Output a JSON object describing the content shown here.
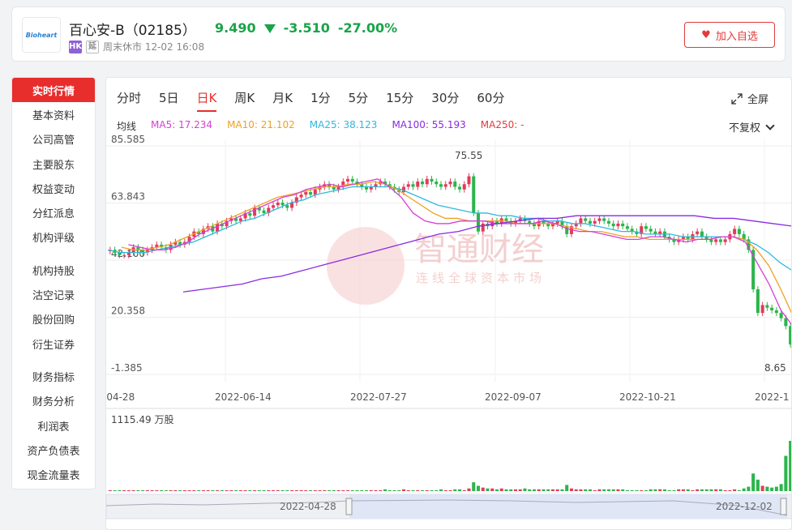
{
  "header": {
    "logo_text": "Bioheart",
    "stock_name": "百心安-B（02185）",
    "price": "9.490",
    "change": "-3.510",
    "change_pct": "-27.00%",
    "market_tag": "HK",
    "delay_tag": "延",
    "status": "周末休市 12-02 16:08",
    "follow_label": "加入自选",
    "down_color": "#1aa34a",
    "up_color": "#e23b3b"
  },
  "sidebar": {
    "groups": [
      [
        "实时行情",
        "基本资料",
        "公司高管",
        "主要股东",
        "权益变动",
        "分红派息",
        "机构评级"
      ],
      [
        "机构持股",
        "沽空记录",
        "股份回购",
        "衍生证券"
      ],
      [
        "财务指标",
        "财务分析",
        "利润表",
        "资产负债表",
        "现金流量表"
      ]
    ]
  },
  "chart": {
    "tabs": [
      "分时",
      "5日",
      "日K",
      "周K",
      "月K",
      "1分",
      "5分",
      "15分",
      "30分",
      "60分"
    ],
    "active_tab": "日K",
    "fullscreen_label": "全屏",
    "ma_label": "均线",
    "ma": [
      {
        "label": "MA5: 17.234",
        "color": "#d63fd6"
      },
      {
        "label": "MA10: 21.102",
        "color": "#f0a020"
      },
      {
        "label": "MA25: 38.123",
        "color": "#2fb8e0"
      },
      {
        "label": "MA100: 55.193",
        "color": "#8a2be2"
      },
      {
        "label": "MA250: -",
        "color": "#e23b3b"
      }
    ],
    "adjust_label": "不复权",
    "y_labels": [
      "85.585",
      "63.843",
      "42.100",
      "20.358",
      "-1.385"
    ],
    "x_labels": [
      "-04-28",
      "2022-06-14",
      "2022-07-27",
      "2022-09-07",
      "2022-10-21",
      "2022-1"
    ],
    "high_label": "75.55",
    "low_label": "8.65",
    "volume_label": "1115.49 万股",
    "nav_start": "2022-04-28",
    "nav_end": "2022-12-02",
    "watermark_title": "智通财经",
    "watermark_sub": "连线全球资本市场"
  },
  "chart_data": {
    "type": "candlestick",
    "ylim": [
      -1.385,
      85.585
    ],
    "close_series": [
      46,
      45,
      44,
      44,
      45,
      47,
      46,
      45,
      46,
      47,
      48,
      47,
      46,
      48,
      49,
      48,
      49,
      51,
      53,
      52,
      54,
      55,
      53,
      56,
      55,
      57,
      58,
      57,
      58,
      60,
      59,
      62,
      61,
      60,
      62,
      63,
      64,
      63,
      62,
      64,
      66,
      67,
      68,
      67,
      69,
      70,
      71,
      70,
      69,
      70,
      72,
      73,
      72,
      71,
      70,
      69,
      70,
      71,
      72,
      71,
      70,
      69,
      68,
      70,
      71,
      70,
      72,
      71,
      73,
      72,
      71,
      70,
      71,
      72,
      70,
      69,
      71,
      74,
      60,
      53,
      56,
      55,
      57,
      56,
      58,
      57,
      56,
      57,
      58,
      57,
      56,
      55,
      57,
      56,
      55,
      56,
      57,
      55,
      52,
      55,
      56,
      58,
      57,
      56,
      57,
      58,
      57,
      56,
      55,
      56,
      55,
      54,
      53,
      52,
      55,
      54,
      53,
      52,
      53,
      51,
      50,
      49,
      50,
      51,
      50,
      52,
      53,
      51,
      50,
      49,
      50,
      49,
      50,
      52,
      54,
      52,
      50,
      46,
      31,
      22,
      25,
      24,
      23,
      22,
      20,
      17,
      10
    ],
    "ma5": [
      48,
      47,
      46,
      46,
      47,
      49,
      52,
      54,
      56,
      58,
      60,
      62,
      64,
      66,
      67,
      69,
      70,
      71,
      70,
      71,
      72,
      73,
      70,
      66,
      60,
      57,
      56,
      56,
      57,
      57,
      57,
      56,
      56,
      56,
      56,
      57,
      56,
      54,
      53,
      53,
      52,
      51,
      50,
      50,
      51,
      51,
      50,
      49,
      50,
      50,
      51,
      51,
      49,
      41,
      33,
      23,
      17
    ],
    "ma10": [
      47,
      46,
      46,
      47,
      48,
      50,
      52,
      54,
      56,
      58,
      60,
      62,
      64,
      66,
      67,
      68,
      69,
      70,
      70,
      71,
      71,
      72,
      71,
      69,
      66,
      63,
      60,
      58,
      58,
      57,
      57,
      57,
      57,
      56,
      56,
      56,
      56,
      55,
      54,
      53,
      53,
      52,
      51,
      51,
      50,
      50,
      50,
      50,
      50,
      50,
      51,
      51,
      50,
      46,
      40,
      31,
      21
    ],
    "ma25": [
      46,
      45,
      45,
      45,
      46,
      47,
      48,
      49,
      51,
      53,
      55,
      57,
      58,
      60,
      62,
      64,
      65,
      67,
      68,
      69,
      70,
      70,
      70,
      70,
      69,
      67,
      65,
      63,
      62,
      61,
      60,
      60,
      59,
      59,
      58,
      58,
      57,
      57,
      56,
      56,
      55,
      54,
      53,
      53,
      52,
      52,
      52,
      51,
      51,
      51,
      51,
      51,
      50,
      48,
      45,
      41,
      38
    ],
    "ma100": [
      30,
      31,
      32,
      33,
      35,
      36,
      38,
      40,
      42,
      44,
      46,
      48,
      50,
      52,
      53,
      55,
      56,
      57,
      58,
      58,
      59,
      59,
      59,
      59,
      59,
      59,
      59,
      58,
      58,
      57,
      56,
      55
    ],
    "volume": [
      1,
      1,
      1,
      1,
      1,
      1,
      1,
      1,
      1,
      1,
      1,
      1,
      1,
      1,
      1,
      1,
      1,
      1,
      1,
      1,
      1,
      1,
      1,
      1,
      1,
      1,
      1,
      1,
      1,
      1,
      1,
      1,
      1,
      1,
      1,
      1,
      1,
      1,
      1,
      1,
      1,
      1,
      1,
      1,
      1,
      1,
      1,
      1,
      1,
      1,
      1,
      1,
      1,
      1,
      1,
      1,
      1,
      1,
      1,
      2,
      1,
      1,
      1,
      2,
      1,
      1,
      1,
      1,
      1,
      1,
      1,
      2,
      1,
      1,
      2,
      2,
      1,
      3,
      10,
      6,
      4,
      3,
      3,
      2,
      3,
      2,
      2,
      2,
      2,
      3,
      2,
      2,
      2,
      2,
      2,
      2,
      2,
      2,
      7,
      3,
      2,
      2,
      2,
      2,
      1,
      2,
      2,
      2,
      2,
      2,
      2,
      1,
      1,
      1,
      1,
      1,
      2,
      2,
      2,
      2,
      1,
      1,
      2,
      2,
      2,
      1,
      2,
      2,
      2,
      2,
      2,
      2,
      1,
      1,
      2,
      1,
      3,
      5,
      20,
      13,
      6,
      5,
      4,
      5,
      8,
      40,
      57
    ]
  }
}
